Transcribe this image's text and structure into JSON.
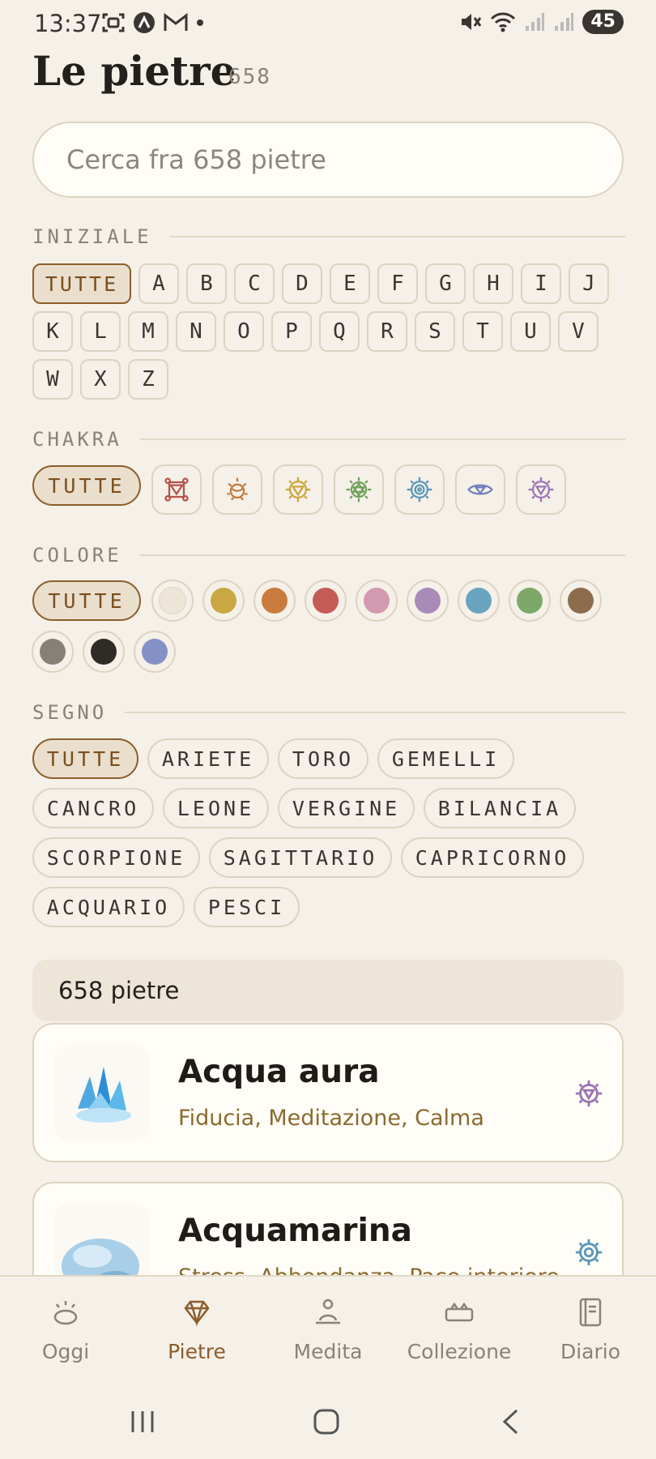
{
  "status": {
    "time": "13:37",
    "battery": "45"
  },
  "header": {
    "title": "Le pietre",
    "count": "658"
  },
  "search": {
    "placeholder": "Cerca fra 658 pietre"
  },
  "sections": {
    "iniziale": "INIZIALE",
    "chakra": "CHAKRA",
    "colore": "COLORE",
    "segno": "SEGNO"
  },
  "letters": [
    "TUTTE",
    "A",
    "B",
    "C",
    "D",
    "E",
    "F",
    "G",
    "H",
    "I",
    "J",
    "K",
    "L",
    "M",
    "N",
    "O",
    "P",
    "Q",
    "R",
    "S",
    "T",
    "U",
    "V",
    "W",
    "X",
    "Z"
  ],
  "chakras": [
    {
      "label": "TUTTE"
    },
    {
      "name": "root-chakra-icon",
      "color": "#b5524a"
    },
    {
      "name": "sacral-chakra-icon",
      "color": "#c47a3c"
    },
    {
      "name": "solar-plexus-chakra-icon",
      "color": "#c9a53a"
    },
    {
      "name": "heart-chakra-icon",
      "color": "#6ea05c"
    },
    {
      "name": "throat-chakra-icon",
      "color": "#5a97b8"
    },
    {
      "name": "third-eye-chakra-icon",
      "color": "#6f7fbf"
    },
    {
      "name": "crown-chakra-icon",
      "color": "#9b74b3"
    }
  ],
  "colors": {
    "all_label": "TUTTE",
    "swatches": [
      "#ece5d8",
      "#c9a844",
      "#c97c3e",
      "#c45c55",
      "#d29aae",
      "#a98bb8",
      "#6aa3c0",
      "#7ea86a",
      "#8b6d4e",
      "#878078",
      "#2f2b27",
      "#8591c6"
    ]
  },
  "signs": [
    "TUTTE",
    "ARIETE",
    "TORO",
    "GEMELLI",
    "CANCRO",
    "LEONE",
    "VERGINE",
    "BILANCIA",
    "SCORPIONE",
    "SAGITTARIO",
    "CAPRICORNO",
    "ACQUARIO",
    "PESCI"
  ],
  "results": {
    "count_label": "658 pietre",
    "items": [
      {
        "name": "Acqua aura",
        "props": "Fiducia, Meditazione, Calma",
        "chakra_color": "#9b74b3"
      },
      {
        "name": "Acquamarina",
        "props": "Stress, Abbondanza, Pace interiore",
        "chakra_color": "#5a97b8"
      }
    ]
  },
  "nav": [
    {
      "label": "Oggi",
      "icon": "sunrise-icon"
    },
    {
      "label": "Pietre",
      "icon": "gem-icon"
    },
    {
      "label": "Medita",
      "icon": "meditate-icon"
    },
    {
      "label": "Collezione",
      "icon": "collection-icon"
    },
    {
      "label": "Diario",
      "icon": "journal-icon"
    }
  ],
  "accent": "#8b5e2b"
}
